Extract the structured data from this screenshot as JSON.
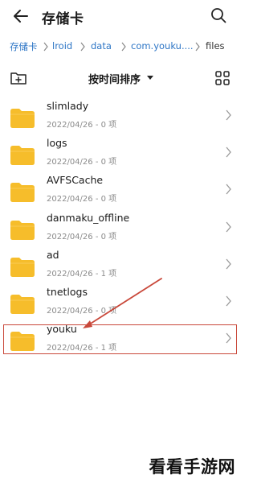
{
  "header": {
    "title": "存储卡",
    "back_icon": "arrow-left-icon",
    "search_icon": "search-icon"
  },
  "breadcrumb": [
    "存储卡",
    "lroid",
    "data",
    "com.youku....",
    "files"
  ],
  "toolbar": {
    "new_folder_icon": "new-folder-icon",
    "sort_label": "按时间排序",
    "grid_icon": "grid-view-icon"
  },
  "files": [
    {
      "name": "slimlady",
      "meta": "2022/04/26 - 0 项"
    },
    {
      "name": "logs",
      "meta": "2022/04/26 - 0 项"
    },
    {
      "name": "AVFSCache",
      "meta": "2022/04/26 - 0 项"
    },
    {
      "name": "danmaku_offline",
      "meta": "2022/04/26 - 0 项"
    },
    {
      "name": "ad",
      "meta": "2022/04/26 - 1 项"
    },
    {
      "name": "tnetlogs",
      "meta": "2022/04/26 - 0 项"
    },
    {
      "name": "youku",
      "meta": "2022/04/26 - 1 项"
    }
  ],
  "colors": {
    "folder": "#f6bd2b",
    "link": "#2e76c6",
    "annotation": "#c9483a"
  },
  "watermark": "看看手游网"
}
